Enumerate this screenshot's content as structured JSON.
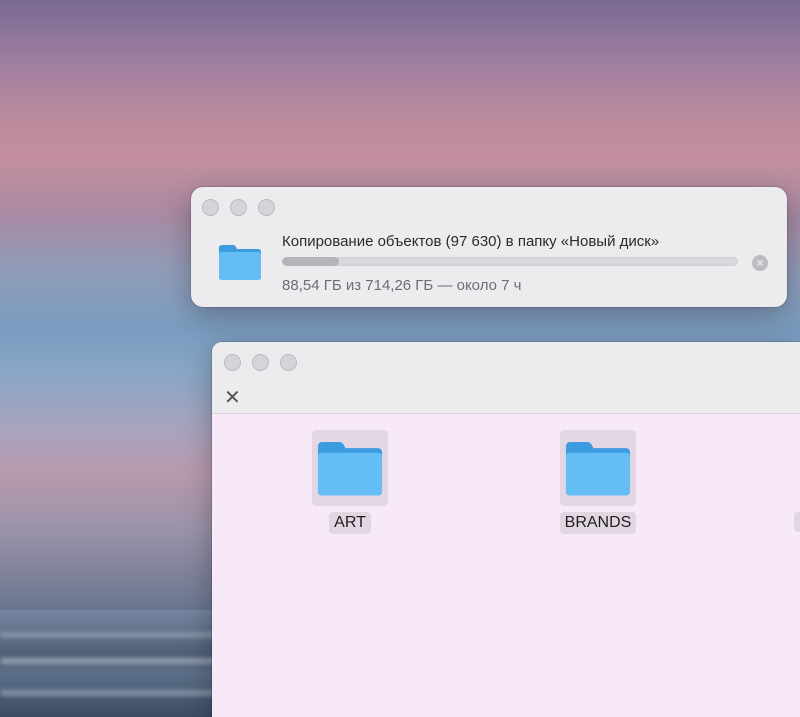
{
  "copy_dialog": {
    "title": "Копирование объектов (97 630) в папку «Новый диск»",
    "status": "88,54 ГБ из 714,26 ГБ — около 7 ч",
    "progress_fraction": 0.124,
    "cancel_glyph": "×",
    "icon": "folder-icon"
  },
  "finder": {
    "toolbar_close_glyph": "✕",
    "items": [
      {
        "label": "ART",
        "icon": "folder-icon"
      },
      {
        "label": "BRANDS",
        "icon": "folder-icon"
      }
    ]
  },
  "colors": {
    "folder_blue": "#5ab3f0",
    "finder_bg": "#f7e9f8",
    "dialog_bg": "#ecebee"
  }
}
